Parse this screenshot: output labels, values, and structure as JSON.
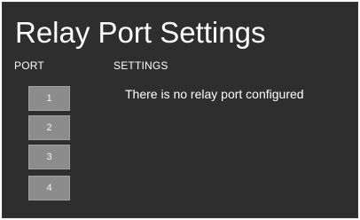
{
  "page": {
    "title": "Relay Port Settings"
  },
  "columns": {
    "port": "PORT",
    "settings": "SETTINGS"
  },
  "ports": [
    {
      "label": "1"
    },
    {
      "label": "2"
    },
    {
      "label": "3"
    },
    {
      "label": "4"
    }
  ],
  "settings": {
    "message": "There is no relay port configured"
  },
  "colors": {
    "background": "#2e2e2e",
    "button": "#8c8c8c",
    "text": "#ffffff"
  }
}
